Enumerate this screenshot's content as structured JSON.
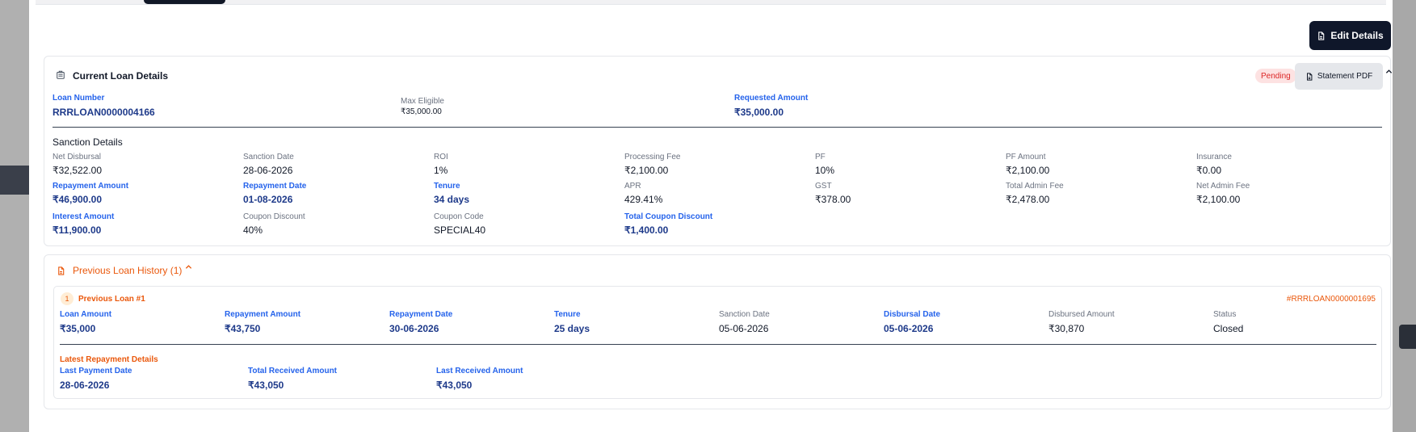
{
  "modal": {
    "edit_button": "Edit Details"
  },
  "current_loan": {
    "title": "Current Loan Details",
    "status": "Pending",
    "statement_button": "Statement PDF",
    "loan_number": {
      "label": "Loan Number",
      "value": "RRRLOAN0000004166"
    },
    "max_eligible": {
      "label": "Max Eligible",
      "value": "₹35,000.00"
    },
    "requested_amount": {
      "label": "Requested Amount",
      "value": "₹35,000.00"
    },
    "sanction_title": "Sanction Details",
    "sanction": [
      {
        "label": "Net Disbursal",
        "value": "₹32,522.00",
        "highlight": false
      },
      {
        "label": "Sanction Date",
        "value": "28-06-2026",
        "highlight": false
      },
      {
        "label": "ROI",
        "value": "1%",
        "highlight": false
      },
      {
        "label": "Processing Fee",
        "value": "₹2,100.00",
        "highlight": false
      },
      {
        "label": "PF",
        "value": "10%",
        "highlight": false
      },
      {
        "label": "PF Amount",
        "value": "₹2,100.00",
        "highlight": false
      },
      {
        "label": "Insurance",
        "value": "₹0.00",
        "highlight": false
      },
      {
        "label": "Repayment Amount",
        "value": "₹46,900.00",
        "highlight": true
      },
      {
        "label": "Repayment Date",
        "value": "01-08-2026",
        "highlight": true
      },
      {
        "label": "Tenure",
        "value": "34 days",
        "highlight": true
      },
      {
        "label": "APR",
        "value": "429.41%",
        "highlight": false
      },
      {
        "label": "GST",
        "value": "₹378.00",
        "highlight": false
      },
      {
        "label": "Total Admin Fee",
        "value": "₹2,478.00",
        "highlight": false
      },
      {
        "label": "Net Admin Fee",
        "value": "₹2,100.00",
        "highlight": false
      },
      {
        "label": "Interest Amount",
        "value": "₹11,900.00",
        "highlight": true
      },
      {
        "label": "Coupon Discount",
        "value": "40%",
        "highlight": false
      },
      {
        "label": "Coupon Code",
        "value": "SPECIAL40",
        "highlight": false
      },
      {
        "label": "Total Coupon Discount",
        "value": "₹1,400.00",
        "highlight": true
      }
    ]
  },
  "history": {
    "title": "Previous Loan History (1)",
    "loan": {
      "index": "1",
      "title": "Previous Loan #1",
      "id": "#RRRLOAN0000001695",
      "fields": [
        {
          "label": "Loan Amount",
          "value": "₹35,000",
          "highlight": true
        },
        {
          "label": "Repayment Amount",
          "value": "₹43,750",
          "highlight": true
        },
        {
          "label": "Repayment Date",
          "value": "30-06-2026",
          "highlight": true
        },
        {
          "label": "Tenure",
          "value": "25 days",
          "highlight": true
        },
        {
          "label": "Sanction Date",
          "value": "05-06-2026",
          "highlight": false
        },
        {
          "label": "Disbursal Date",
          "value": "05-06-2026",
          "highlight": true
        },
        {
          "label": "Disbursed Amount",
          "value": "₹30,870",
          "highlight": false
        },
        {
          "label": "Status",
          "value": "Closed",
          "highlight": false
        }
      ],
      "repayment_title": "Latest Repayment Details",
      "repayment": [
        {
          "label": "Last Payment Date",
          "value": "28-06-2026"
        },
        {
          "label": "Total Received Amount",
          "value": "₹43,050"
        },
        {
          "label": "Last Received Amount",
          "value": "₹43,050"
        }
      ]
    }
  }
}
